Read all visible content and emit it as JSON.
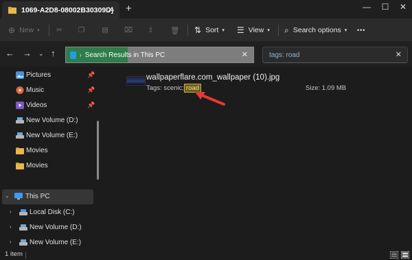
{
  "window": {
    "tab_title": "1069-A2D8-08002B30309D}",
    "tab_close": "✕",
    "new_tab": "+",
    "minimize": "—",
    "maximize": "☐",
    "close": "✕"
  },
  "toolbar": {
    "new_label": "New",
    "sort_label": "Sort",
    "view_label": "View",
    "search_options_label": "Search options",
    "more_label": "•••"
  },
  "address_bar": {
    "path_label": "Search Results in This PC",
    "search_text": "tags: road",
    "clear": "✕"
  },
  "sidebar": {
    "quick_access": [
      {
        "label": "Pictures",
        "icon": "pictures-icon",
        "pinned": true
      },
      {
        "label": "Music",
        "icon": "music-icon",
        "pinned": true
      },
      {
        "label": "Videos",
        "icon": "videos-icon",
        "pinned": true
      },
      {
        "label": "New Volume (D:)",
        "icon": "drive-icon",
        "pinned": false
      },
      {
        "label": "New Volume (E:)",
        "icon": "drive-icon",
        "pinned": false
      },
      {
        "label": "Movies",
        "icon": "folder-icon",
        "pinned": false
      },
      {
        "label": "Movies",
        "icon": "folder-icon",
        "pinned": false
      }
    ],
    "this_pc": "This PC",
    "drives": [
      {
        "label": "Local Disk (C:)"
      },
      {
        "label": "New Volume (D:)"
      },
      {
        "label": "New Volume (E:)"
      }
    ]
  },
  "results": [
    {
      "name": "wallpaperflare.com_wallpaper (10).jpg",
      "tags_prefix": "Tags: scenic;",
      "tag_highlight": "road",
      "size": "Size: 1.09 MB"
    }
  ],
  "status": {
    "item_count": "1 item"
  },
  "colors": {
    "accent_green": "#2e7d4a",
    "arrow_red": "#e53935",
    "highlight_border": "#c9b33a"
  }
}
